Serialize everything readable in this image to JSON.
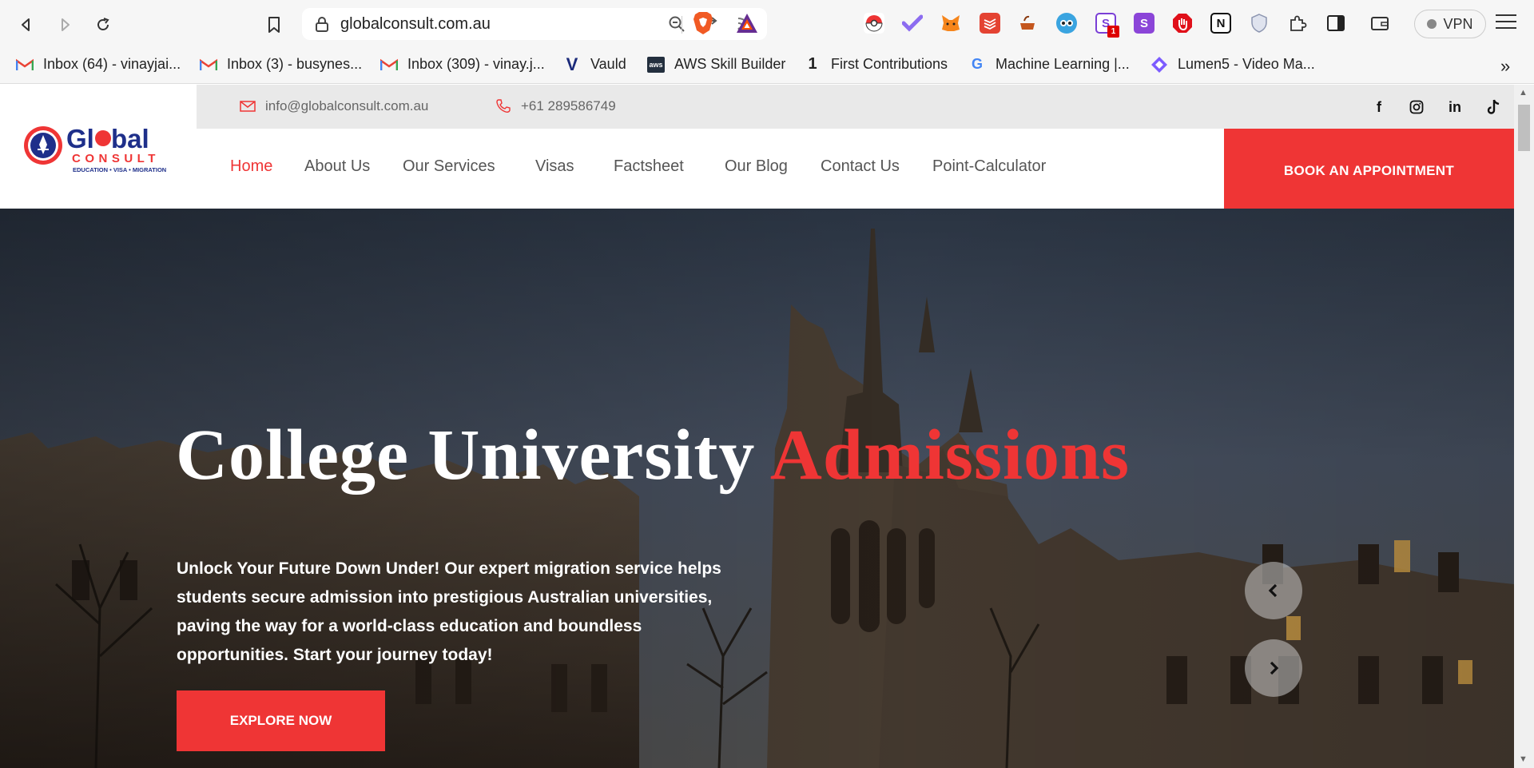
{
  "browser": {
    "url": "globalconsult.com.au",
    "vpn_label": "VPN",
    "extension_badge": "1",
    "bookmarks": [
      {
        "label": "Inbox (64) - vinayjai...",
        "icon": "gmail-icon"
      },
      {
        "label": "Inbox (3) - busynes...",
        "icon": "gmail-icon"
      },
      {
        "label": "Inbox (309) - vinay.j...",
        "icon": "gmail-icon"
      },
      {
        "label": "Vauld",
        "icon": "vauld-icon"
      },
      {
        "label": "AWS Skill Builder",
        "icon": "aws-icon"
      },
      {
        "label": "First Contributions",
        "icon": "first-contributions-icon"
      },
      {
        "label": "Machine Learning  |...",
        "icon": "google-icon"
      },
      {
        "label": "Lumen5 - Video Ma...",
        "icon": "lumen5-icon"
      }
    ],
    "bookmarks_more": "»"
  },
  "site": {
    "email": "info@globalconsult.com.au",
    "phone": "+61 289586749",
    "logo": {
      "word1": "Gl",
      "word1b": "bal",
      "word2": "CONSULT",
      "tagline": "EDUCATION • VISA • MIGRATION"
    },
    "nav": [
      "Home",
      "About Us",
      "Our Services",
      "Visas",
      "Factsheet",
      "Our Blog",
      "Contact Us",
      "Point-Calculator"
    ],
    "book_button": "BOOK AN APPOINTMENT",
    "social": [
      "facebook-icon",
      "instagram-icon",
      "linkedin-icon",
      "tiktok-icon"
    ],
    "hero": {
      "title_main": "College University",
      "title_accent": "Admissions",
      "text": "Unlock Your Future Down Under! Our expert migration service helps students secure admission into prestigious Australian universities, paving the way for a world-class education and boundless opportunities. Start your journey today!",
      "cta": "EXPLORE NOW",
      "prev": "‹",
      "next": "›"
    }
  },
  "colors": {
    "accent": "#ef3535",
    "topbar": "#e9e9e9",
    "logo_blue": "#1e2f8a"
  }
}
